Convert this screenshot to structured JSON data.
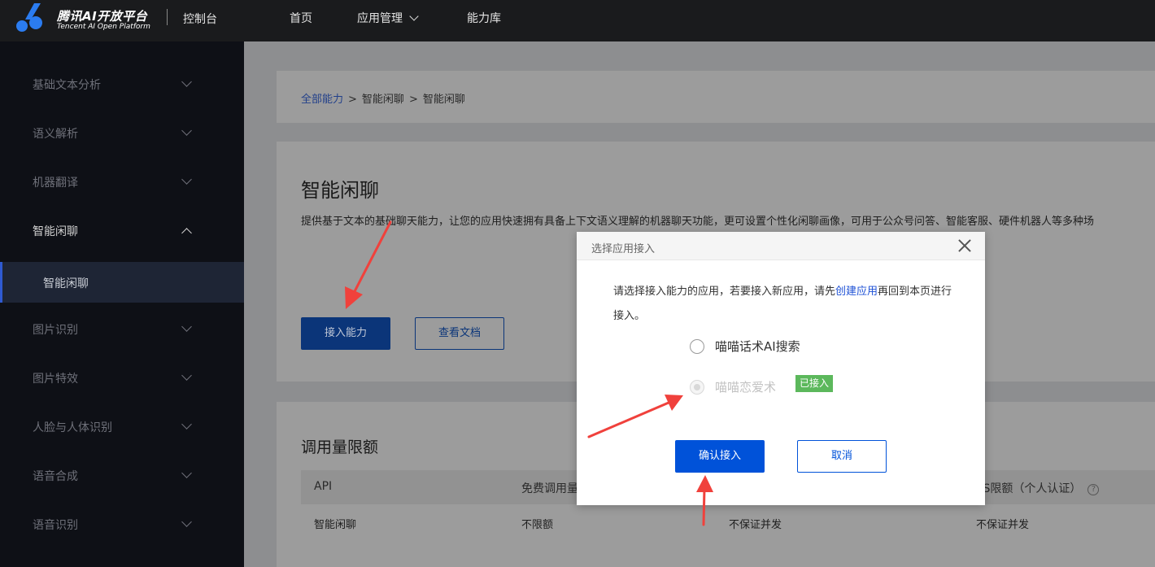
{
  "header": {
    "logo_cn": "腾讯AI开放平台",
    "logo_en": "Tencent AI Open Platform",
    "console": "控制台",
    "nav": [
      "首页",
      "应用管理",
      "能力库"
    ]
  },
  "sidebar": {
    "items": [
      {
        "label": "基础文本分析"
      },
      {
        "label": "语义解析"
      },
      {
        "label": "机器翻译"
      },
      {
        "label": "智能闲聊"
      },
      {
        "label": "图片识别"
      },
      {
        "label": "图片特效"
      },
      {
        "label": "人脸与人体识别"
      },
      {
        "label": "语音合成"
      },
      {
        "label": "语音识别"
      }
    ],
    "sub_active": "智能闲聊"
  },
  "breadcrumb": {
    "root": "全部能力",
    "sep": ">",
    "level1": "智能闲聊",
    "level2": "智能闲聊"
  },
  "main": {
    "title": "智能闲聊",
    "description": "提供基于文本的基础聊天能力，让您的应用快速拥有具备上下文语义理解的机器聊天功能，更可设置个性化闲聊画像，可用于公众号问答、智能客服、硬件机器人等多种场",
    "btn_access": "接入能力",
    "btn_docs": "查看文档",
    "quota_title": "调用量限额",
    "table": {
      "headers": [
        "API",
        "免费调用量",
        "PS限额（个人认证）"
      ],
      "row": [
        "智能闲聊",
        "不限额",
        "不保证并发",
        "不保证并发"
      ]
    }
  },
  "modal": {
    "title": "选择应用接入",
    "text_before": "请选择接入能力的应用，若要接入新应用，请先",
    "link": "创建应用",
    "text_after": "再回到本页进行接入。",
    "options": [
      {
        "label": "喵喵话术AI搜索",
        "disabled": false
      },
      {
        "label": "喵喵恋爱术",
        "disabled": true,
        "badge": "已接入"
      }
    ],
    "confirm": "确认接入",
    "cancel": "取消"
  },
  "colors": {
    "primary": "#0052d9",
    "annotation_arrow": "#f0413c",
    "badge": "#5cb85c"
  }
}
